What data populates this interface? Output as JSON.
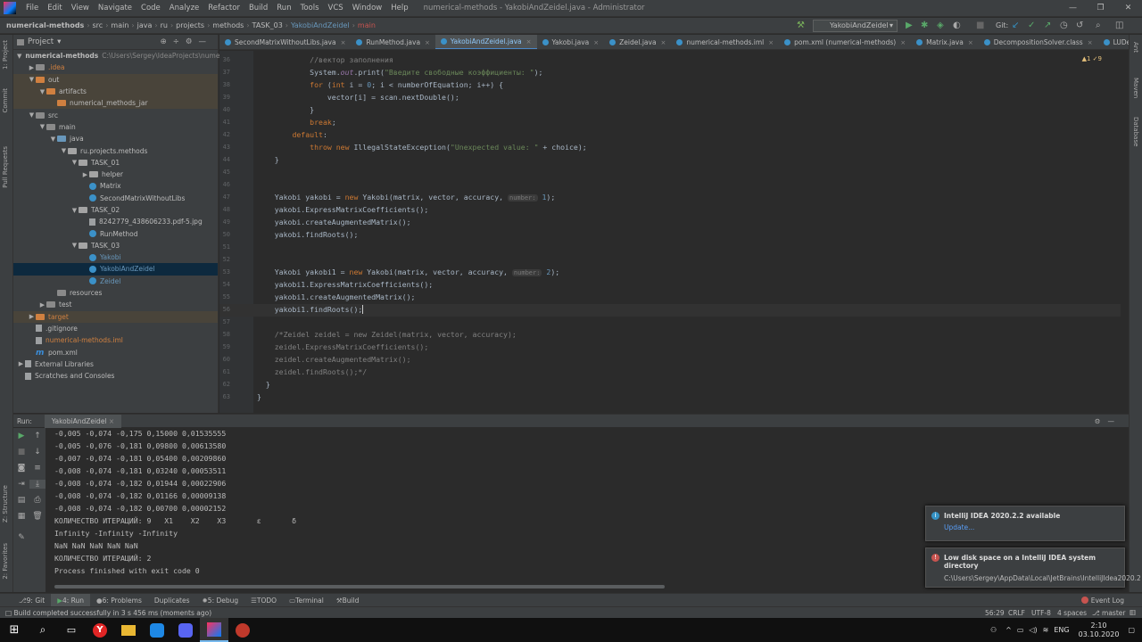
{
  "menu": {
    "items": [
      "File",
      "Edit",
      "View",
      "Navigate",
      "Code",
      "Analyze",
      "Refactor",
      "Build",
      "Run",
      "Tools",
      "VCS",
      "Window",
      "Help"
    ],
    "window_title": "numerical-methods - YakobiAndZeidel.java - Administrator"
  },
  "breadcrumbs": [
    "numerical-methods",
    "src",
    "main",
    "java",
    "ru",
    "projects",
    "methods",
    "TASK_03",
    "YakobiAndZeidel",
    "main"
  ],
  "toolbar": {
    "run_config": "YakobiAndZeidel",
    "git_label": "Git:"
  },
  "project_panel": {
    "title": "Project",
    "tree": [
      {
        "label": "numerical-methods",
        "extra": "C:\\Users\\Sergey\\IdeaProjects\\nume",
        "indent": 0,
        "arrow": "▼",
        "icon": "folder",
        "bold": true
      },
      {
        "label": ".idea",
        "indent": 1,
        "arrow": "▶",
        "icon": "folder",
        "color": "#d08040"
      },
      {
        "label": "out",
        "indent": 1,
        "arrow": "▼",
        "icon": "folder-orange",
        "excluded": true
      },
      {
        "label": "artifacts",
        "indent": 2,
        "arrow": "▼",
        "icon": "folder-orange",
        "excluded": true
      },
      {
        "label": "numerical_methods_jar",
        "indent": 3,
        "arrow": "",
        "icon": "folder-orange",
        "excluded": true
      },
      {
        "label": "src",
        "indent": 1,
        "arrow": "▼",
        "icon": "folder"
      },
      {
        "label": "main",
        "indent": 2,
        "arrow": "▼",
        "icon": "folder"
      },
      {
        "label": "java",
        "indent": 3,
        "arrow": "▼",
        "icon": "folder-blue"
      },
      {
        "label": "ru.projects.methods",
        "indent": 4,
        "arrow": "▼",
        "icon": "pkg"
      },
      {
        "label": "TASK_01",
        "indent": 5,
        "arrow": "▼",
        "icon": "pkg"
      },
      {
        "label": "helper",
        "indent": 6,
        "arrow": "▶",
        "icon": "pkg"
      },
      {
        "label": "Matrix",
        "indent": 6,
        "arrow": "",
        "icon": "class"
      },
      {
        "label": "SecondMatrixWithoutLibs",
        "indent": 6,
        "arrow": "",
        "icon": "class"
      },
      {
        "label": "TASK_02",
        "indent": 5,
        "arrow": "▼",
        "icon": "pkg"
      },
      {
        "label": "8242779_438606233.pdf-5.jpg",
        "indent": 6,
        "arrow": "",
        "icon": "file"
      },
      {
        "label": "RunMethod",
        "indent": 6,
        "arrow": "",
        "icon": "class"
      },
      {
        "label": "TASK_03",
        "indent": 5,
        "arrow": "▼",
        "icon": "pkg"
      },
      {
        "label": "Yakobi",
        "indent": 6,
        "arrow": "",
        "icon": "class",
        "color": "#6897bb"
      },
      {
        "label": "YakobiAndZeidel",
        "indent": 6,
        "arrow": "",
        "icon": "class",
        "selected": true,
        "color": "#6897bb"
      },
      {
        "label": "Zeidel",
        "indent": 6,
        "arrow": "",
        "icon": "class",
        "color": "#6897bb"
      },
      {
        "label": "resources",
        "indent": 3,
        "arrow": "",
        "icon": "folder"
      },
      {
        "label": "test",
        "indent": 2,
        "arrow": "▶",
        "icon": "folder"
      },
      {
        "label": "target",
        "indent": 1,
        "arrow": "▶",
        "icon": "folder-orange",
        "excluded": true,
        "color": "#d08040"
      },
      {
        "label": ".gitignore",
        "indent": 1,
        "arrow": "",
        "icon": "file"
      },
      {
        "label": "numerical-methods.iml",
        "indent": 1,
        "arrow": "",
        "icon": "file",
        "color": "#d08040"
      },
      {
        "label": "pom.xml",
        "indent": 1,
        "arrow": "",
        "icon": "maven"
      },
      {
        "label": "External Libraries",
        "indent": 0,
        "arrow": "▶",
        "icon": "lib"
      },
      {
        "label": "Scratches and Consoles",
        "indent": 0,
        "arrow": "",
        "icon": "scratch"
      }
    ]
  },
  "editor_tabs": [
    {
      "label": "SecondMatrixWithoutLibs.java"
    },
    {
      "label": "RunMethod.java"
    },
    {
      "label": "YakobiAndZeidel.java",
      "active": true
    },
    {
      "label": "Yakobi.java"
    },
    {
      "label": "Zeidel.java"
    },
    {
      "label": "numerical-methods.iml"
    },
    {
      "label": "pom.xml (numerical-methods)"
    },
    {
      "label": "Matrix.java"
    },
    {
      "label": "DecompositionSolver.class"
    },
    {
      "label": "LUDecomp"
    }
  ],
  "inspections": "▲1 ✓9",
  "code_lines": [
    {
      "n": "36",
      "html": "            <span class='cm'>//вектор заполнения</span>"
    },
    {
      "n": "37",
      "html": "            System.<span class='ital'>out</span>.print(<span class='str'>\"Введите свободные коэффициенты: \"</span>);"
    },
    {
      "n": "38",
      "html": "            <span class='kw'>for</span> (<span class='kw'>int</span> i = <span class='num'>0</span>; i &lt; numberOfEquation; i++) {"
    },
    {
      "n": "39",
      "html": "                vector[i] = scan.nextDouble();"
    },
    {
      "n": "40",
      "html": "            }"
    },
    {
      "n": "41",
      "html": "            <span class='kw'>break</span>;"
    },
    {
      "n": "42",
      "html": "        <span class='kw'>default</span>:"
    },
    {
      "n": "43",
      "html": "            <span class='kw'>throw new</span> IllegalStateException(<span class='str'>\"Unexpected value: \"</span> + choice);"
    },
    {
      "n": "44",
      "html": "    }"
    },
    {
      "n": "45",
      "html": ""
    },
    {
      "n": "46",
      "html": ""
    },
    {
      "n": "47",
      "html": "    Yakobi yakobi = <span class='kw'>new</span> Yakobi(matrix, vector, accuracy, <span class='hint'>number:</span> <span class='num'>1</span>);"
    },
    {
      "n": "48",
      "html": "    yakobi.ExpressMatrixCoefficients();"
    },
    {
      "n": "49",
      "html": "    yakobi.createAugmentedMatrix();"
    },
    {
      "n": "50",
      "html": "    yakobi.findRoots();"
    },
    {
      "n": "51",
      "html": ""
    },
    {
      "n": "52",
      "html": ""
    },
    {
      "n": "53",
      "html": "    Yakobi yakobi1 = <span class='kw'>new</span> Yakobi(matrix, vector, accuracy, <span class='hint'>number:</span> <span class='num'>2</span>);"
    },
    {
      "n": "54",
      "html": "    yakobi1.ExpressMatrixCoefficients();"
    },
    {
      "n": "55",
      "html": "    yakobi1.createAugmentedMatrix();"
    },
    {
      "n": "56",
      "html": "    yakobi1.findRoots();",
      "current": true
    },
    {
      "n": "57",
      "html": ""
    },
    {
      "n": "58",
      "html": "    <span class='cm'>/*Zeidel zeidel = new Zeidel(matrix, vector, accuracy);</span>"
    },
    {
      "n": "59",
      "html": "    <span class='cm'>zeidel.ExpressMatrixCoefficients();</span>"
    },
    {
      "n": "60",
      "html": "    <span class='cm'>zeidel.createAugmentedMatrix();</span>"
    },
    {
      "n": "61",
      "html": "    <span class='cm'>zeidel.findRoots();*/</span>"
    },
    {
      "n": "62",
      "html": "  }"
    },
    {
      "n": "63",
      "html": "}"
    }
  ],
  "run_panel": {
    "label": "Run:",
    "tab": "YakobiAndZeidel"
  },
  "console_lines": [
    "-0,005 -0,074 -0,175 0,15000 0,01535555",
    "-0,005 -0,076 -0,181 0,09800 0,00613580",
    "-0,007 -0,074 -0,181 0,05400 0,00209860",
    "-0,008 -0,074 -0,181 0,03240 0,00053511",
    "-0,008 -0,074 -0,182 0,01944 0,00022906",
    "-0,008 -0,074 -0,182 0,01166 0,00009138",
    "-0,008 -0,074 -0,182 0,00700 0,00002152",
    "КОЛИЧЕСТВО ИТЕРАЦИЙ: 9   X1    X2    X3       ε       δ",
    "Infinity -Infinity -Infinity",
    "NaN NaN NaN NaN NaN",
    "КОЛИЧЕСТВО ИТЕРАЦИЙ: 2",
    "Process finished with exit code 0"
  ],
  "notifications": [
    {
      "title": "IntelliJ IDEA 2020.2.2 available",
      "link": "Update...",
      "kind": "info",
      "color": "#3592c4"
    },
    {
      "title": "Low disk space on a IntelliJ IDEA system directory",
      "body": "C:\\Users\\Sergey\\AppData\\Local\\JetBrains\\IntelliJIdea2020.2",
      "kind": "error",
      "color": "#c75450"
    }
  ],
  "bottom_tabs": [
    {
      "label": "9: Git",
      "icon": "⎇"
    },
    {
      "label": "4: Run",
      "icon": "▶",
      "active": true
    },
    {
      "label": "6: Problems",
      "icon": "●"
    },
    {
      "label": "Duplicates",
      "icon": ""
    },
    {
      "label": "5: Debug",
      "icon": "✹"
    },
    {
      "label": "TODO",
      "icon": "☰"
    },
    {
      "label": "Terminal",
      "icon": "▭"
    },
    {
      "label": "Build",
      "icon": "⚒"
    }
  ],
  "event_log": "Event Log",
  "status": {
    "message": "Build completed successfully in 3 s 456 ms (moments ago)",
    "position": "56:29",
    "line_sep": "CRLF",
    "encoding": "UTF-8",
    "indent": "4 spaces",
    "branch": "master"
  },
  "left_strip_tabs": [
    "1: Project",
    "Commit",
    "Pull Requests",
    "Z: Structure",
    "2: Favorites"
  ],
  "right_strip_tabs": [
    "Ant",
    "Maven",
    "Database"
  ],
  "taskbar": {
    "lang": "ENG",
    "time": "2:10",
    "date": "03.10.2020"
  }
}
